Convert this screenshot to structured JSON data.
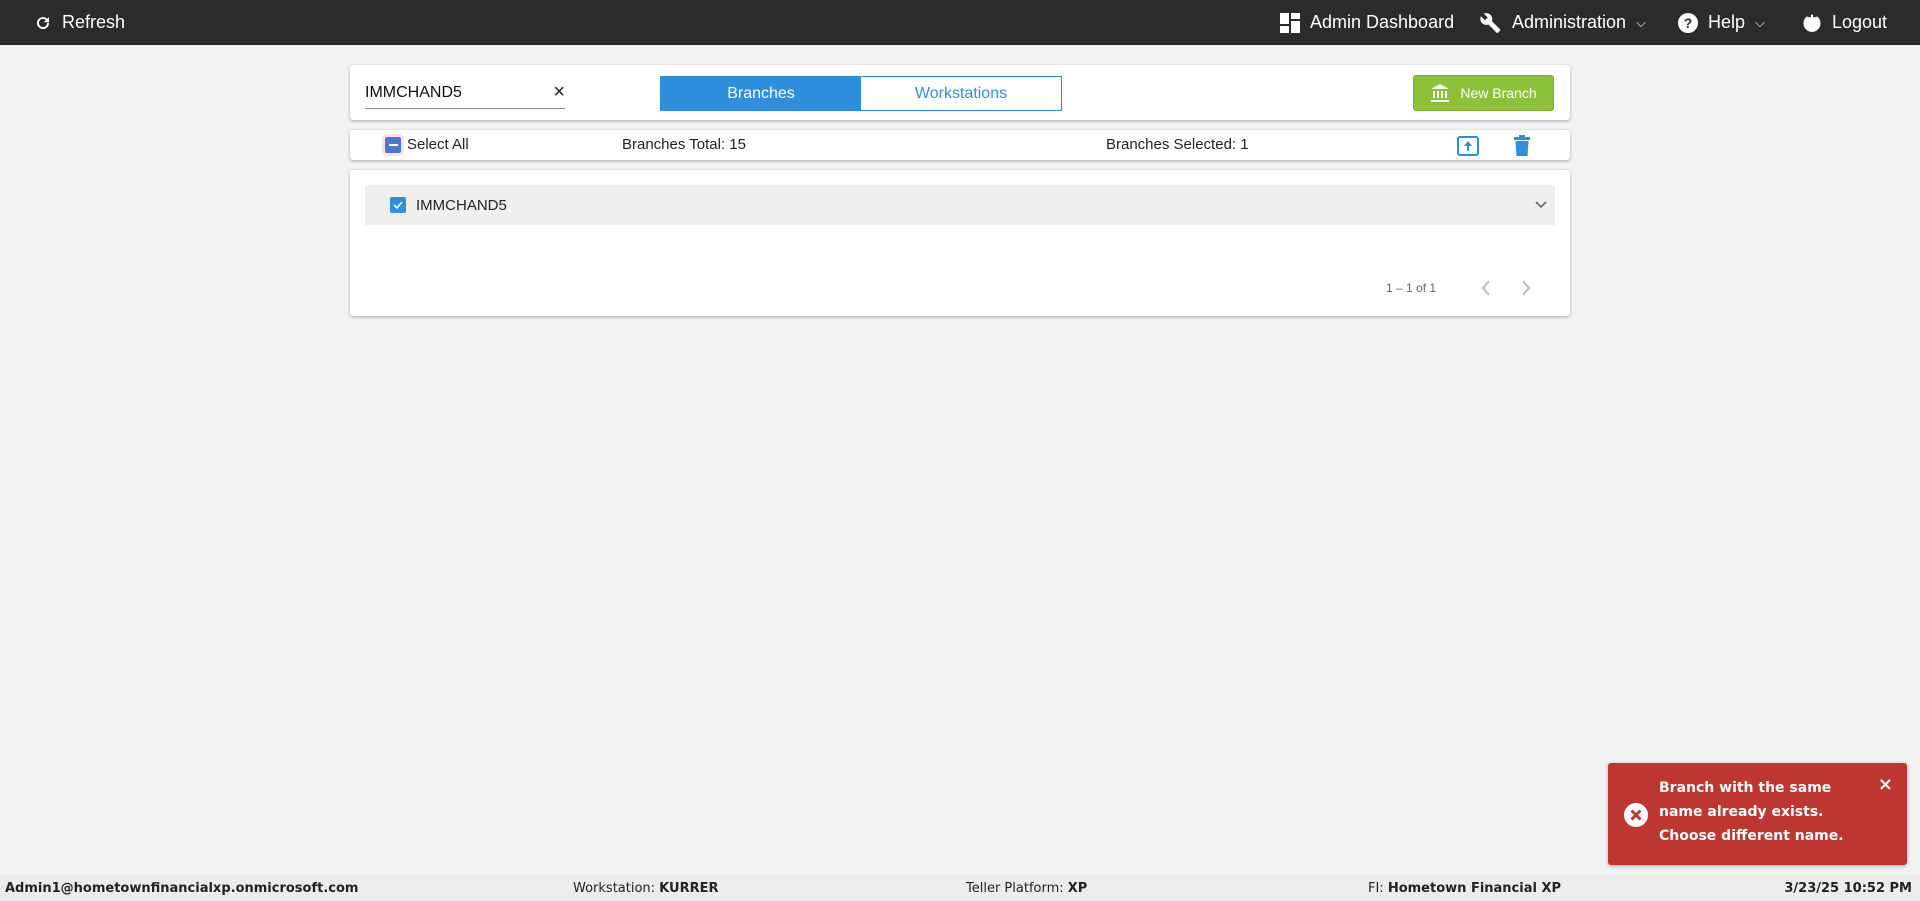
{
  "topbar": {
    "refresh": "Refresh",
    "admin_dashboard": "Admin Dashboard",
    "administration": "Administration",
    "help": "Help",
    "logout": "Logout"
  },
  "search": {
    "value": "IMMCHAND5",
    "clear": "×"
  },
  "tabs": [
    {
      "label": "Branches",
      "active": true
    },
    {
      "label": "Workstations",
      "active": false
    }
  ],
  "new_branch": "New Branch",
  "toolbar": {
    "select_all": "Select All",
    "total": "Branches Total: 15",
    "selected": "Branches Selected: 1"
  },
  "list": {
    "items": [
      {
        "name": "IMMCHAND5",
        "checked": true
      }
    ],
    "pagination": "1 – 1 of 1"
  },
  "toast": {
    "message": "Branch with the same name already exists. Choose different name.",
    "close": "×",
    "color": "#bd3631"
  },
  "status": {
    "user": "Admin1@hometownfinancialxp.onmicrosoft.com",
    "workstation_label": "Workstation: ",
    "workstation": "KURRER",
    "platform_label": "Teller Platform: ",
    "platform": "XP",
    "fi_label": "FI: ",
    "fi": "Hometown Financial XP",
    "datetime": "3/23/25 10:52 PM"
  },
  "colors": {
    "accent": "#2f8fdc",
    "success": "#8dc13a",
    "topbar": "#2b2b2b"
  }
}
